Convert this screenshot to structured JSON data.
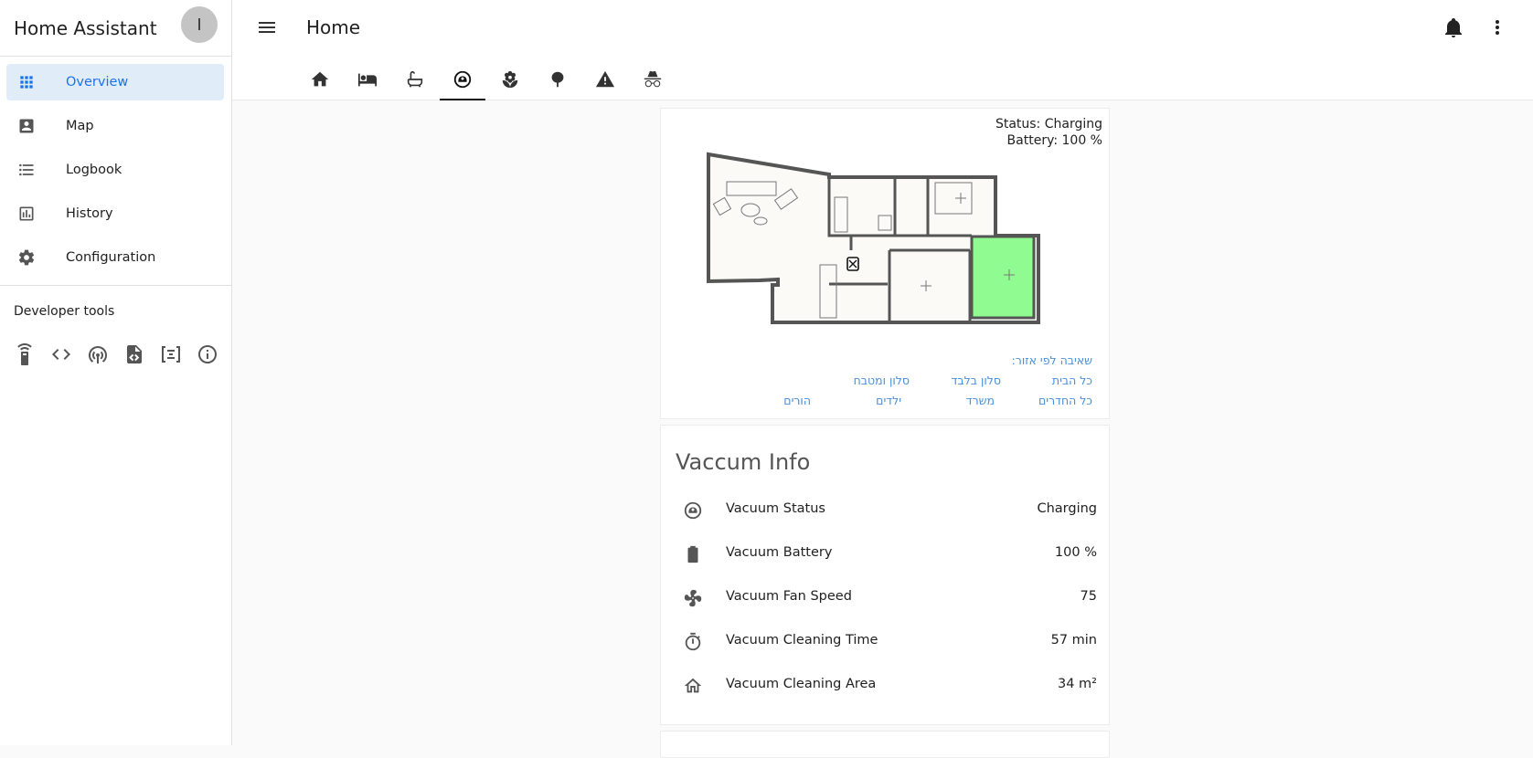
{
  "sidebar": {
    "title": "Home Assistant",
    "avatar_letter": "I",
    "items": [
      {
        "label": "Overview",
        "icon": "apps-icon"
      },
      {
        "label": "Map",
        "icon": "account-box-icon"
      },
      {
        "label": "Logbook",
        "icon": "format-list-icon"
      },
      {
        "label": "History",
        "icon": "chart-box-icon"
      },
      {
        "label": "Configuration",
        "icon": "gear-icon"
      }
    ],
    "developer_title": "Developer tools",
    "developer_tools": [
      "remote-icon",
      "code-icon",
      "antenna-icon",
      "file-code-icon",
      "template-icon",
      "info-icon"
    ]
  },
  "header": {
    "title": "Home",
    "tabs": [
      "home-icon",
      "bed-icon",
      "bathtub-icon",
      "robot-vacuum-icon",
      "flower-icon",
      "tree-icon",
      "alert-icon",
      "incognito-icon"
    ],
    "active_tab": 3
  },
  "vacuum_map": {
    "status": "Status: Charging",
    "battery": "Battery: 100 %",
    "zones_title": "שאיבה לפי אזור:",
    "zones": {
      "whole_house": "כל הבית",
      "living_only": "סלון בלבד",
      "living_kitchen": "סלון ומטבח",
      "all_rooms": "כל החדרים",
      "office": "משרד",
      "kids": "ילדים",
      "parents": "הורים"
    },
    "highlight_color": "#90fb90"
  },
  "vacuum_info": {
    "title": "Vaccum Info",
    "rows": [
      {
        "icon": "robot-vacuum-icon",
        "name": "Vacuum Status",
        "value": "Charging"
      },
      {
        "icon": "battery-icon",
        "name": "Vacuum Battery",
        "value": "100 %"
      },
      {
        "icon": "fan-icon",
        "name": "Vacuum Fan Speed",
        "value": "75"
      },
      {
        "icon": "timer-icon",
        "name": "Vacuum Cleaning Time",
        "value": "57 min"
      },
      {
        "icon": "home-outline-icon",
        "name": "Vacuum Cleaning Area",
        "value": "34 m²"
      }
    ]
  },
  "colors": {
    "accent": "#1a73e8",
    "active_bg": "#e1ecf9",
    "link": "#4a90d9"
  }
}
